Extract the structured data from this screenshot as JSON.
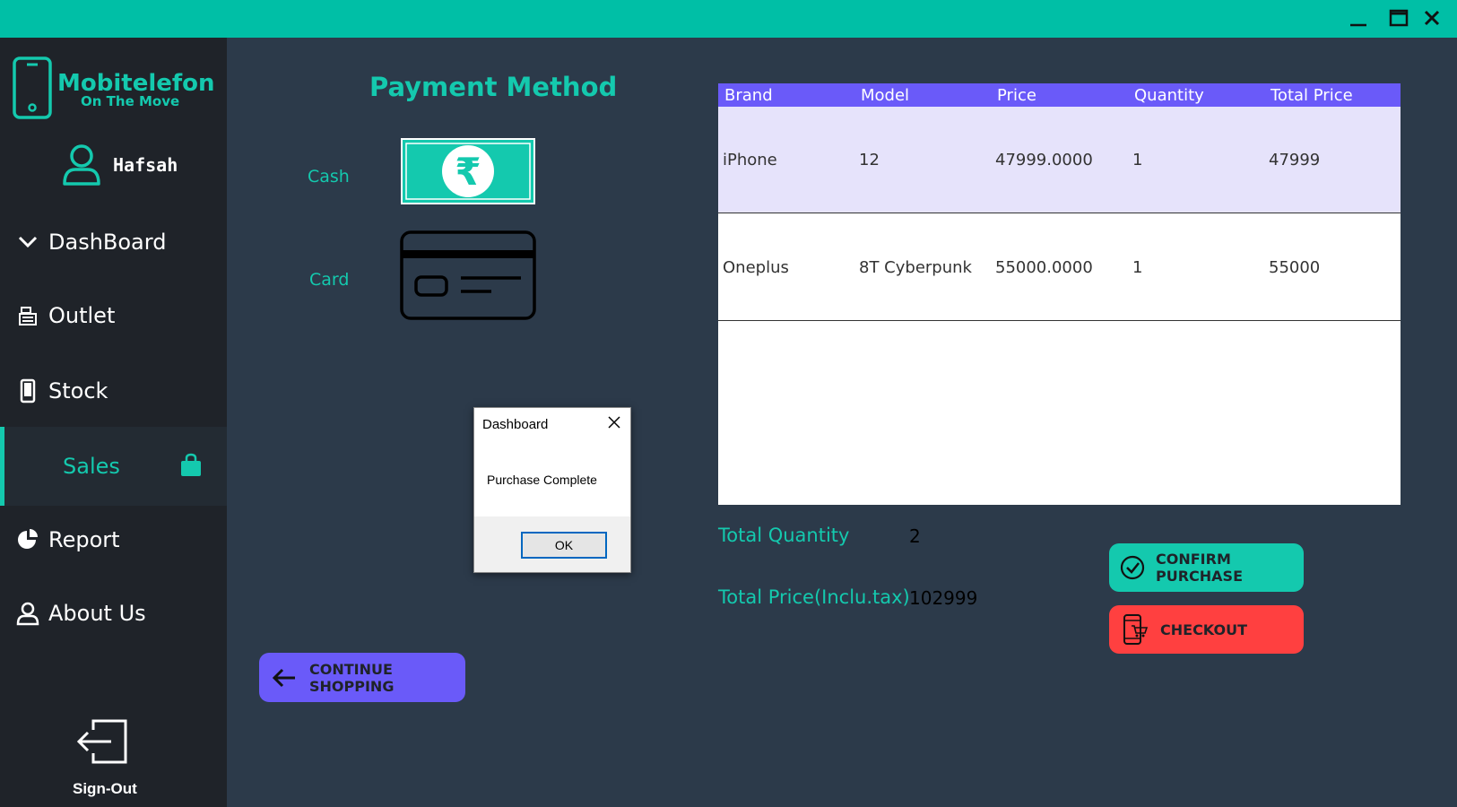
{
  "window": {
    "minimize_icon": "minimize-icon",
    "maximize_icon": "maximize-icon",
    "close_icon": "close-icon"
  },
  "sidebar": {
    "logo_title": "Mobitelefon",
    "logo_subtitle": "On The Move",
    "user_name": "Hafsah",
    "items": [
      {
        "label": "DashBoard",
        "icon": "chevron-down-icon"
      },
      {
        "label": "Outlet",
        "icon": "cash-register-icon"
      },
      {
        "label": "Stock",
        "icon": "phone-icon"
      },
      {
        "label": "Sales",
        "icon": "shopping-bag-icon",
        "active": true
      },
      {
        "label": "Report",
        "icon": "pie-chart-icon"
      },
      {
        "label": "About Us",
        "icon": "user-icon"
      }
    ],
    "signout_label": "Sign-Out"
  },
  "payment": {
    "title": "Payment Method",
    "cash_label": "Cash",
    "card_label": "Card"
  },
  "cart": {
    "columns": [
      "Brand",
      "Model",
      "Price",
      "Quantity",
      "Total Price"
    ],
    "rows": [
      [
        "iPhone",
        "12",
        "47999.0000",
        "1",
        "47999"
      ],
      [
        "Oneplus",
        "8T Cyberpunk",
        "55000.0000",
        "1",
        "55000"
      ]
    ]
  },
  "summary": {
    "total_quantity_label": "Total Quantity",
    "total_quantity_value": "2",
    "total_price_label": "Total Price(Inclu.tax)",
    "total_price_value": "102999"
  },
  "buttons": {
    "confirm": "CONFIRM PURCHASE",
    "checkout": "CHECKOUT",
    "continue": "CONTINUE SHOPPING"
  },
  "dialog": {
    "title": "Dashboard",
    "message": "Purchase Complete",
    "ok": "OK"
  },
  "colors": {
    "accent": "#14c9ae",
    "sidebar": "#1f2329",
    "main": "#2c3a4a",
    "header_purple": "#6a5af9",
    "checkout_red": "#ff4040"
  }
}
